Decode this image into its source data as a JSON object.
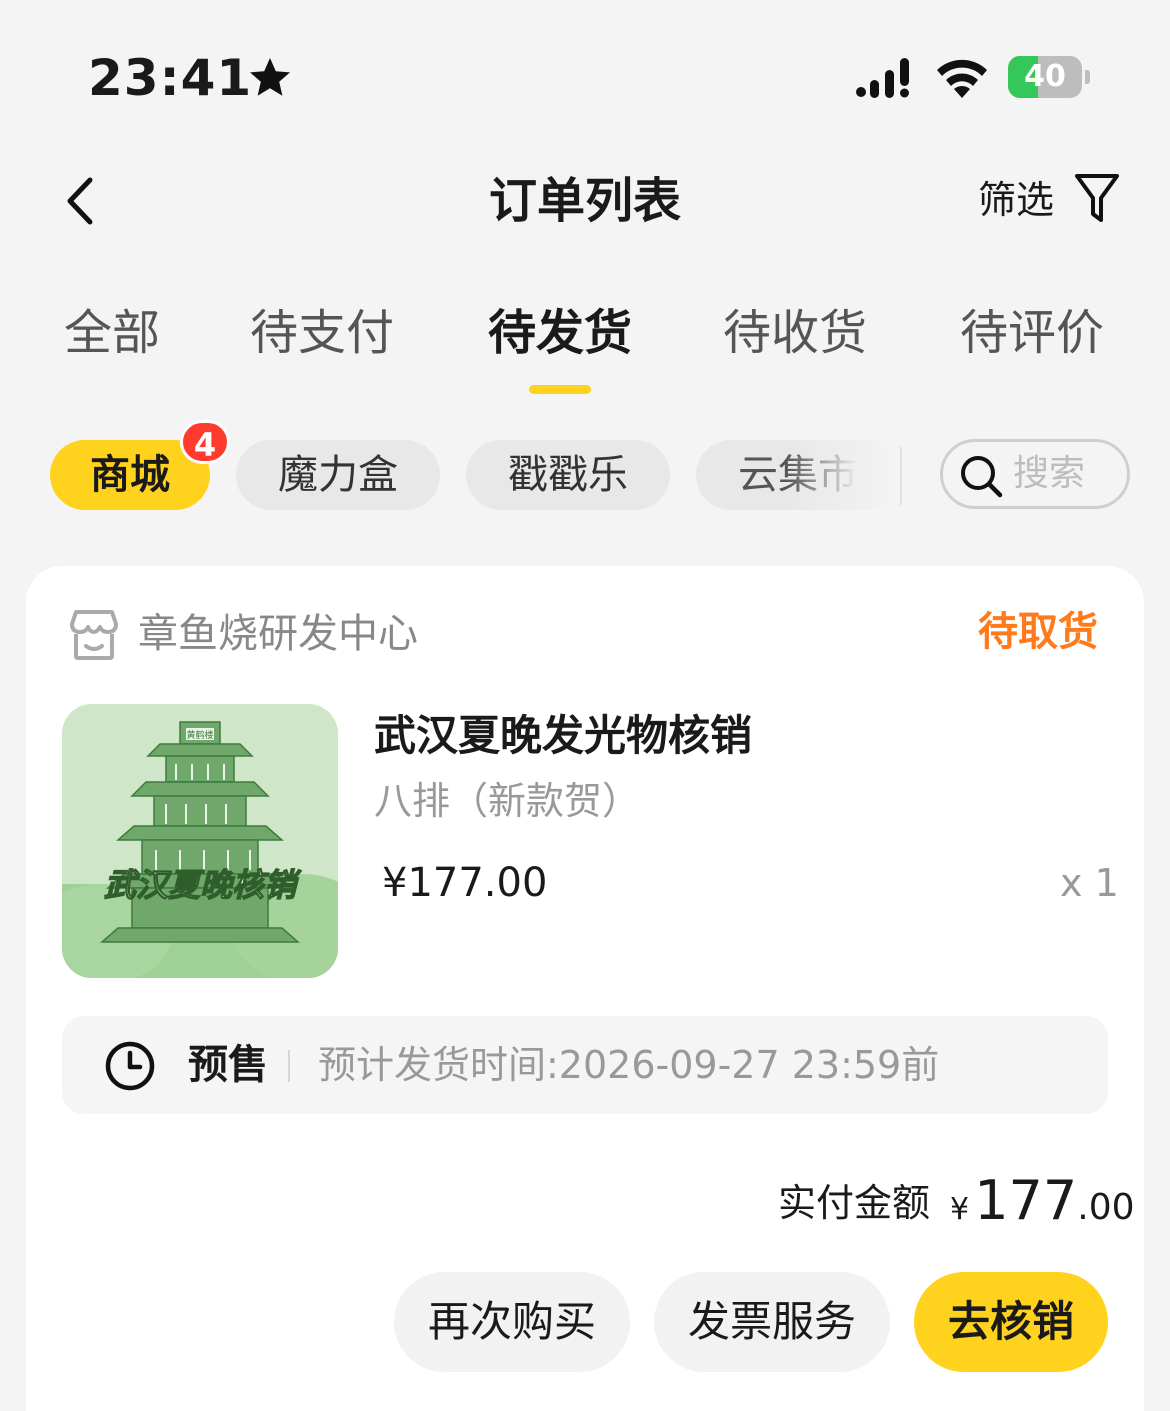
{
  "status_bar": {
    "time": "23:41",
    "battery": "40",
    "battery_level_percent": 40
  },
  "header": {
    "title": "订单列表",
    "filter_label": "筛选"
  },
  "tabs": [
    {
      "label": "全部",
      "active": false
    },
    {
      "label": "待支付",
      "active": false
    },
    {
      "label": "待发货",
      "active": true
    },
    {
      "label": "待收货",
      "active": false
    },
    {
      "label": "待评价",
      "active": false
    }
  ],
  "chips": [
    {
      "label": "商城",
      "active": true,
      "badge": "4"
    },
    {
      "label": "魔力盒",
      "active": false
    },
    {
      "label": "戳戳乐",
      "active": false
    },
    {
      "label": "云集市",
      "active": false
    }
  ],
  "search": {
    "placeholder": "搜索"
  },
  "order": {
    "shop_name": "章鱼烧研发中心",
    "status": "待取货",
    "product": {
      "name": "武汉夏晚发光物核销",
      "spec": "八排（新款贺）",
      "price": "¥177.00",
      "qty": "x 1",
      "image_caption": "武汉夏晚核销",
      "image_plaque": "黄鹤楼"
    },
    "presale": {
      "label": "预售",
      "time_text": "预计发货时间:2026-09-27 23:59前"
    },
    "paid": {
      "label": "实付金额",
      "currency": "¥",
      "integer": "177",
      "decimal": ".00"
    },
    "buttons": {
      "rebuy": "再次购买",
      "invoice": "发票服务",
      "redeem": "去核销"
    }
  },
  "colors": {
    "accent": "#ffd21e",
    "status_orange": "#ff7a1a",
    "badge_red": "#ff3b30",
    "background": "#f4f4f4"
  },
  "icons": [
    "star-icon",
    "signal-icon",
    "wifi-icon",
    "battery-icon",
    "back-icon",
    "filter-icon",
    "search-icon",
    "shop-icon",
    "clock-icon"
  ]
}
